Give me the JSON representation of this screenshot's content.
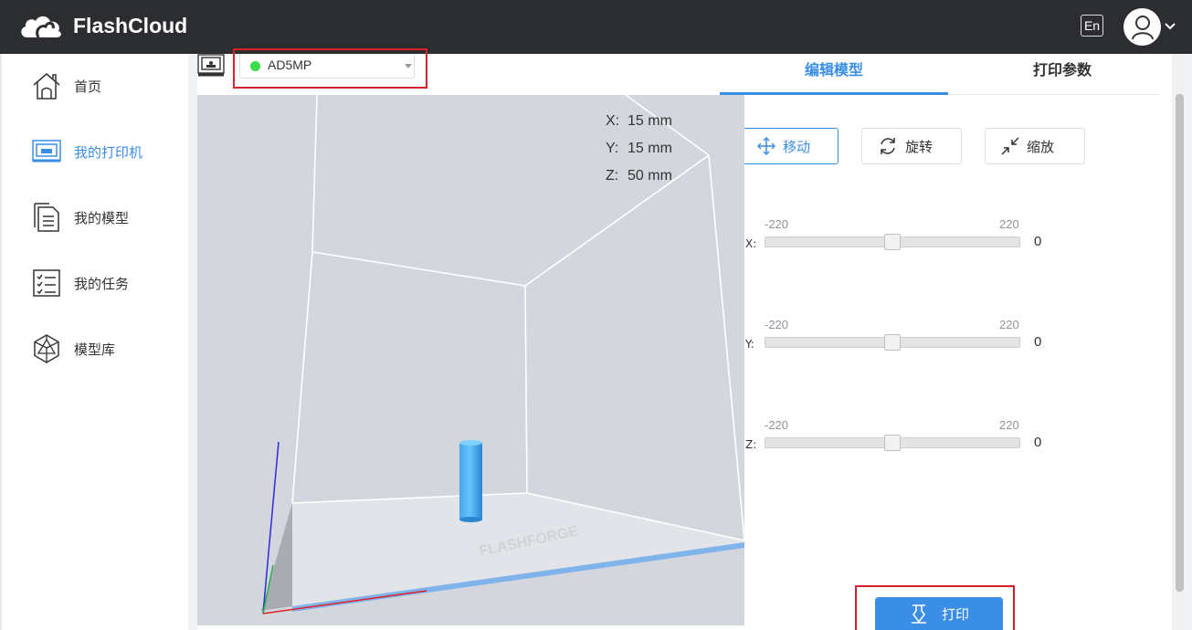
{
  "header": {
    "app_name": "FlashCloud",
    "lang_button": "En"
  },
  "sidebar": {
    "items": [
      {
        "label": "首页",
        "icon": "home-icon",
        "active": false
      },
      {
        "label": "我的打印机",
        "icon": "printer-icon",
        "active": true
      },
      {
        "label": "我的模型",
        "icon": "document-icon",
        "active": false
      },
      {
        "label": "我的任务",
        "icon": "task-list-icon",
        "active": false
      },
      {
        "label": "模型库",
        "icon": "model-library-icon",
        "active": false
      }
    ]
  },
  "printer": {
    "name": "AD5MP",
    "status": "online",
    "status_color": "#3ddc4b"
  },
  "viewport": {
    "dims": {
      "x_label": "X:",
      "x_value": "15 mm",
      "y_label": "Y:",
      "y_value": "15 mm",
      "z_label": "Z:",
      "z_value": "50 mm"
    },
    "bed_watermark": "FLASHFORGE"
  },
  "tabs": {
    "edit": "编辑模型",
    "params": "打印参数"
  },
  "tools": {
    "move": "移动",
    "rotate": "旋转",
    "scale": "缩放"
  },
  "sliders": [
    {
      "axis": "X:",
      "min": "-220",
      "max": "220",
      "value": "0",
      "fraction": 0.5
    },
    {
      "axis": "Y:",
      "min": "-220",
      "max": "220",
      "value": "0",
      "fraction": 0.5
    },
    {
      "axis": "Z:",
      "min": "-220",
      "max": "220",
      "value": "0",
      "fraction": 0.5
    }
  ],
  "actions": {
    "print": "打印"
  },
  "colors": {
    "accent": "#3a8ee6",
    "highlight": "#d8202b",
    "topbar": "#2b2d31"
  }
}
